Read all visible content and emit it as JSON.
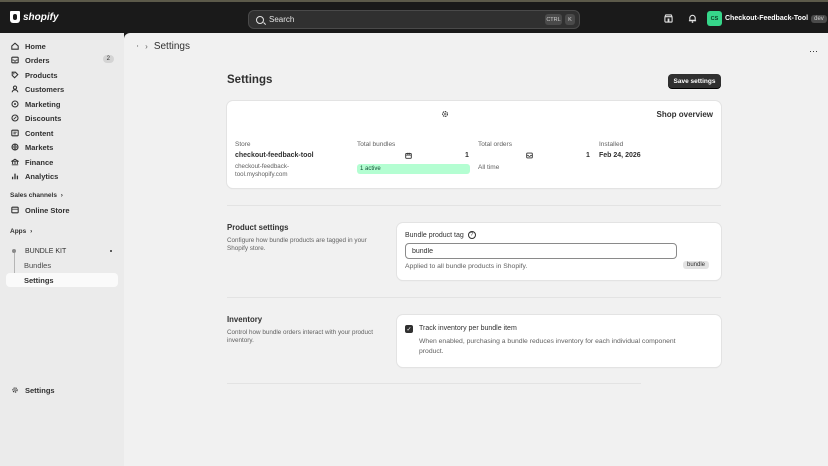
{
  "topbar": {
    "logo_text": "shopify",
    "search_placeholder": "Search",
    "shortcut_ctrl": "CTRL",
    "shortcut_k": "K",
    "store_initials": "CS",
    "store_name": "Checkout-Feedback-Tool",
    "env_badge": "dev"
  },
  "sidebar": {
    "items": [
      {
        "label": "Home",
        "icon": "home-icon"
      },
      {
        "label": "Orders",
        "icon": "orders-icon",
        "count": "2"
      },
      {
        "label": "Products",
        "icon": "products-icon"
      },
      {
        "label": "Customers",
        "icon": "customers-icon"
      },
      {
        "label": "Marketing",
        "icon": "marketing-icon"
      },
      {
        "label": "Discounts",
        "icon": "discounts-icon"
      },
      {
        "label": "Content",
        "icon": "content-icon"
      },
      {
        "label": "Markets",
        "icon": "markets-icon"
      },
      {
        "label": "Finance",
        "icon": "finance-icon"
      },
      {
        "label": "Analytics",
        "icon": "analytics-icon"
      }
    ],
    "sales_channels_label": "Sales channels",
    "online_store_label": "Online Store",
    "apps_label": "Apps",
    "app_name": "BUNDLE KIT",
    "app_sub_items": [
      "Bundles",
      "Settings"
    ],
    "settings_label": "Settings"
  },
  "main": {
    "breadcrumb_title": "Settings",
    "page_title": "Settings",
    "save_label": "Save settings",
    "overview": {
      "title": "Shop overview",
      "store_label": "Store",
      "store_name": "checkout-feedback-tool",
      "store_domain_line1": "checkout-feedback-",
      "store_domain_line2": "tool.myshopify.com",
      "bundles_label": "Total bundles",
      "bundles_value": "1",
      "bundles_active": "1 active",
      "orders_label": "Total orders",
      "orders_value": "1",
      "orders_period": "All time",
      "installed_label": "Installed",
      "installed_value": "Feb 24, 2026"
    },
    "product_settings": {
      "title": "Product settings",
      "desc_line1": "Configure how bundle products are tagged in your",
      "desc_line2": "Shopify store.",
      "field_label": "Bundle product tag",
      "field_value": "bundle",
      "help": "Applied to all bundle products in Shopify.",
      "tag_chip": "bundle"
    },
    "inventory": {
      "title": "Inventory",
      "desc_line1": "Control how bundle orders interact with your product",
      "desc_line2": "inventory.",
      "checkbox_label": "Track inventory per bundle item",
      "checkbox_checked": true,
      "help_line1": "When enabled, purchasing a bundle reduces inventory for each individual component",
      "help_line2": "product."
    }
  }
}
